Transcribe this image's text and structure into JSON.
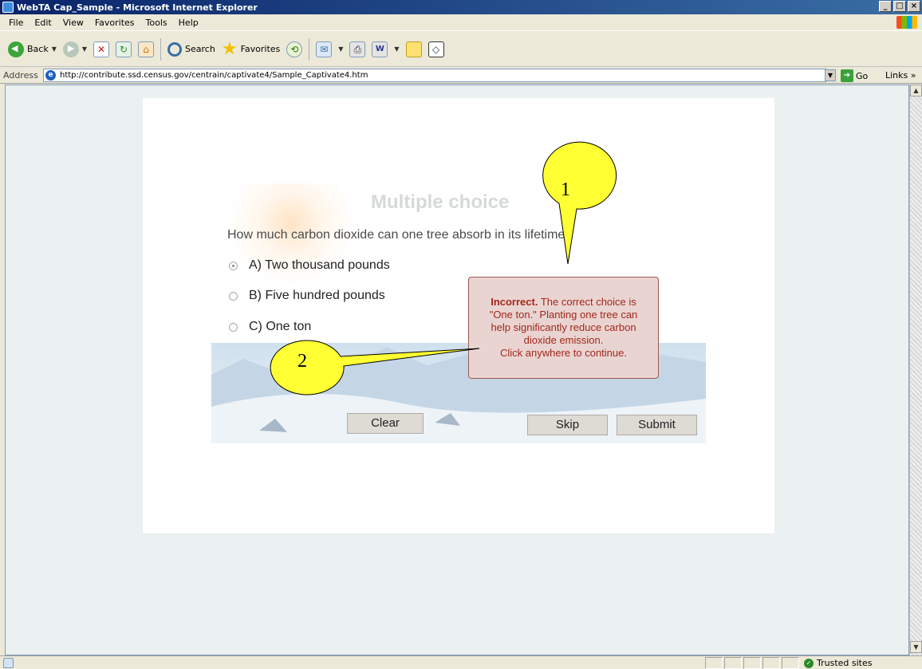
{
  "window": {
    "title": "WebTA Cap_Sample - Microsoft Internet Explorer",
    "controls": [
      "_",
      "□",
      "×"
    ]
  },
  "menu": [
    "File",
    "Edit",
    "View",
    "Favorites",
    "Tools",
    "Help"
  ],
  "toolbar": {
    "back_label": "Back",
    "search_label": "Search",
    "favorites_label": "Favorites"
  },
  "address": {
    "label": "Address",
    "url": "http://contribute.ssd.census.gov/centrain/captivate4/Sample_Captivate4.htm",
    "go_label": "Go",
    "links_label": "Links »"
  },
  "quiz": {
    "title": "Multiple choice",
    "question": "How much carbon dioxide can one tree absorb in its lifetime?",
    "options": [
      {
        "label": "A) Two thousand pounds",
        "selected": true
      },
      {
        "label": "B) Five hundred pounds",
        "selected": false
      },
      {
        "label": "C) One ton",
        "selected": false
      }
    ],
    "buttons": {
      "clear": "Clear",
      "skip": "Skip",
      "submit": "Submit"
    },
    "feedback": {
      "heading": "Incorrect.",
      "line1": "The correct choice is",
      "line2": "\"One ton.\" Planting one tree can",
      "line3": "help significantly reduce carbon",
      "line4": "dioxide emission.",
      "line5": "Click anywhere to continue."
    }
  },
  "callouts": [
    "1",
    "2"
  ],
  "status": {
    "zone": "Trusted sites"
  },
  "colors": {
    "titlebar": "#0a246a",
    "feedback_bg": "#ead4d2",
    "feedback_text": "#a0281a",
    "callout_fill": "#ffff33"
  }
}
